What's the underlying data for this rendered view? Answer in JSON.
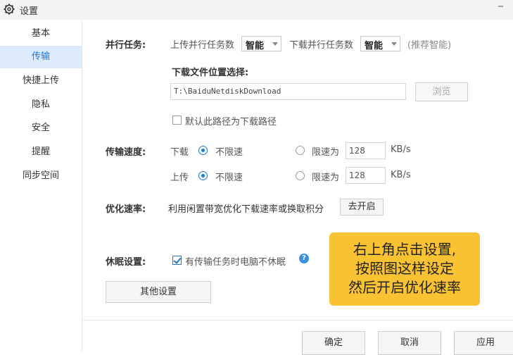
{
  "window": {
    "title": "设置",
    "icon": "gear-icon"
  },
  "sidebar": {
    "items": [
      {
        "label": "基本"
      },
      {
        "label": "传输"
      },
      {
        "label": "快捷上传"
      },
      {
        "label": "隐私"
      },
      {
        "label": "安全"
      },
      {
        "label": "提醒"
      },
      {
        "label": "同步空间"
      }
    ],
    "active_index": 1,
    "active_color": "#1f78d1"
  },
  "parallel": {
    "label": "并行任务:",
    "upload_label": "上传并行任务数",
    "upload_value": "智能",
    "download_label": "下载并行任务数",
    "download_value": "智能",
    "hint": "(推荐智能)"
  },
  "download_location": {
    "label": "下载文件位置选择:",
    "path": "T:\\BaiduNetdiskDownload",
    "browse_label": "浏览",
    "default_checkbox_label": "默认此路径为下载路径",
    "default_checked": false
  },
  "speed": {
    "label": "传输速度:",
    "download_label": "下载",
    "upload_label": "上传",
    "unlimited_label": "不限速",
    "limit_label": "限速为",
    "download_limit_value": "128",
    "upload_limit_value": "128",
    "unit": "KB/s",
    "download_mode": "unlimited",
    "upload_mode": "unlimited"
  },
  "optimize": {
    "label": "优化速率:",
    "description": "利用闲置带宽优化下载速率或换取积分",
    "button_label": "去开启"
  },
  "sleep": {
    "label": "休眠设置:",
    "checkbox_label": "有传输任务时电脑不休眠",
    "checked": true,
    "help_icon": "help-icon"
  },
  "other_settings_label": "其他设置",
  "footer": {
    "ok_label": "确定",
    "cancel_label": "取消",
    "apply_label": "应用"
  },
  "annotation": {
    "lines": [
      "右上角点击设置,",
      "按照图这样设定",
      "然后开启优化速率"
    ],
    "background": "#f9c232"
  }
}
